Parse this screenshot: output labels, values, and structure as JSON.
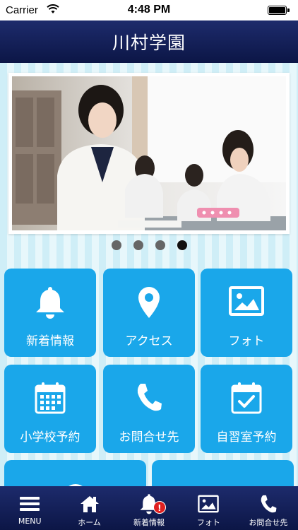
{
  "status_bar": {
    "carrier": "Carrier",
    "time": "4:48 PM"
  },
  "header": {
    "title": "川村学園"
  },
  "slider": {
    "image_description_icon": "classroom-photo",
    "page_count": 4,
    "active_index": 4
  },
  "tiles": [
    {
      "label": "新着情報",
      "icon": "bell-icon"
    },
    {
      "label": "アクセス",
      "icon": "location-pin-icon"
    },
    {
      "label": "フォト",
      "icon": "photo-icon"
    },
    {
      "label": "小学校予約",
      "icon": "calendar-icon"
    },
    {
      "label": "お問合せ先",
      "icon": "phone-icon"
    },
    {
      "label": "自習室予約",
      "icon": "calendar-check-icon"
    }
  ],
  "bottom_nav": [
    {
      "label": "MENU",
      "icon": "hamburger-menu-icon"
    },
    {
      "label": "ホーム",
      "icon": "home-icon"
    },
    {
      "label": "新着情報",
      "icon": "bell-icon",
      "badge": "!"
    },
    {
      "label": "フォト",
      "icon": "photo-icon"
    },
    {
      "label": "お問合せ先",
      "icon": "phone-icon"
    }
  ],
  "colors": {
    "header": "#1d2b6c",
    "tile": "#1aa7ea",
    "badge": "#e02020"
  }
}
